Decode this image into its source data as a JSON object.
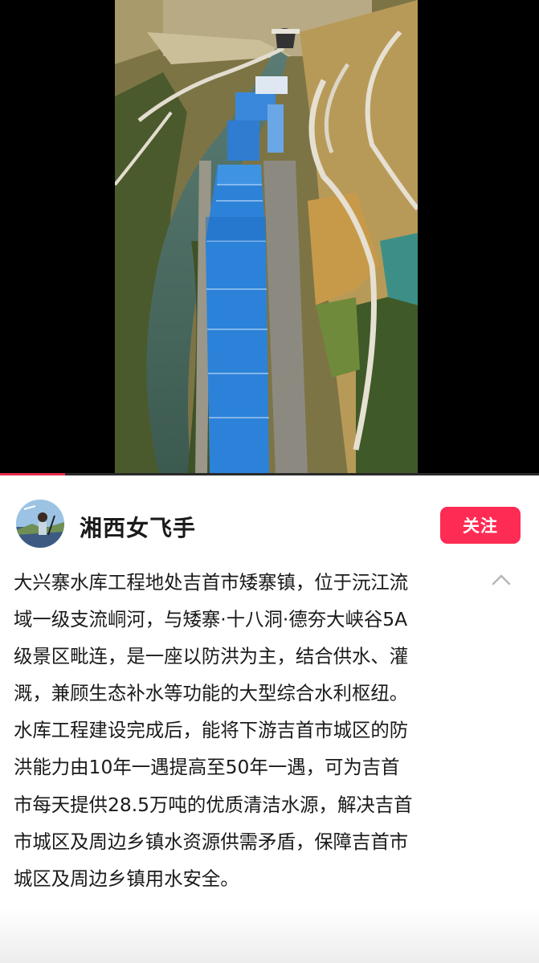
{
  "video": {
    "scene_icon": "aerial-reservoir-construction-image",
    "progress_fraction": 0.12,
    "progress_color": "#e62e4d"
  },
  "author": {
    "name": "湘西女飞手",
    "avatar_icon": "user-avatar-icon",
    "follow_label": "关注",
    "follow_color": "#fe2c55"
  },
  "description": {
    "lines": [
      "大兴寨水库工程地处吉首市矮寨镇，位于沅江流",
      "域一级支流峒河，与矮寨·十八洞·德夯大峡谷5A",
      "级景区毗连，是一座以防洪为主，结合供水、灌",
      "溉，兼顾生态补水等功能的大型综合水利枢纽。",
      "水库工程建设完成后，能将下游吉首市城区的防",
      "洪能力由10年一遇提高至50年一遇，可为吉首",
      "市每天提供28.5万吨的优质清洁水源，解决吉首",
      "市城区及周边乡镇水资源供需矛盾，保障吉首市",
      "城区及周边乡镇用水安全。"
    ],
    "collapse_icon": "chevron-up-icon"
  }
}
